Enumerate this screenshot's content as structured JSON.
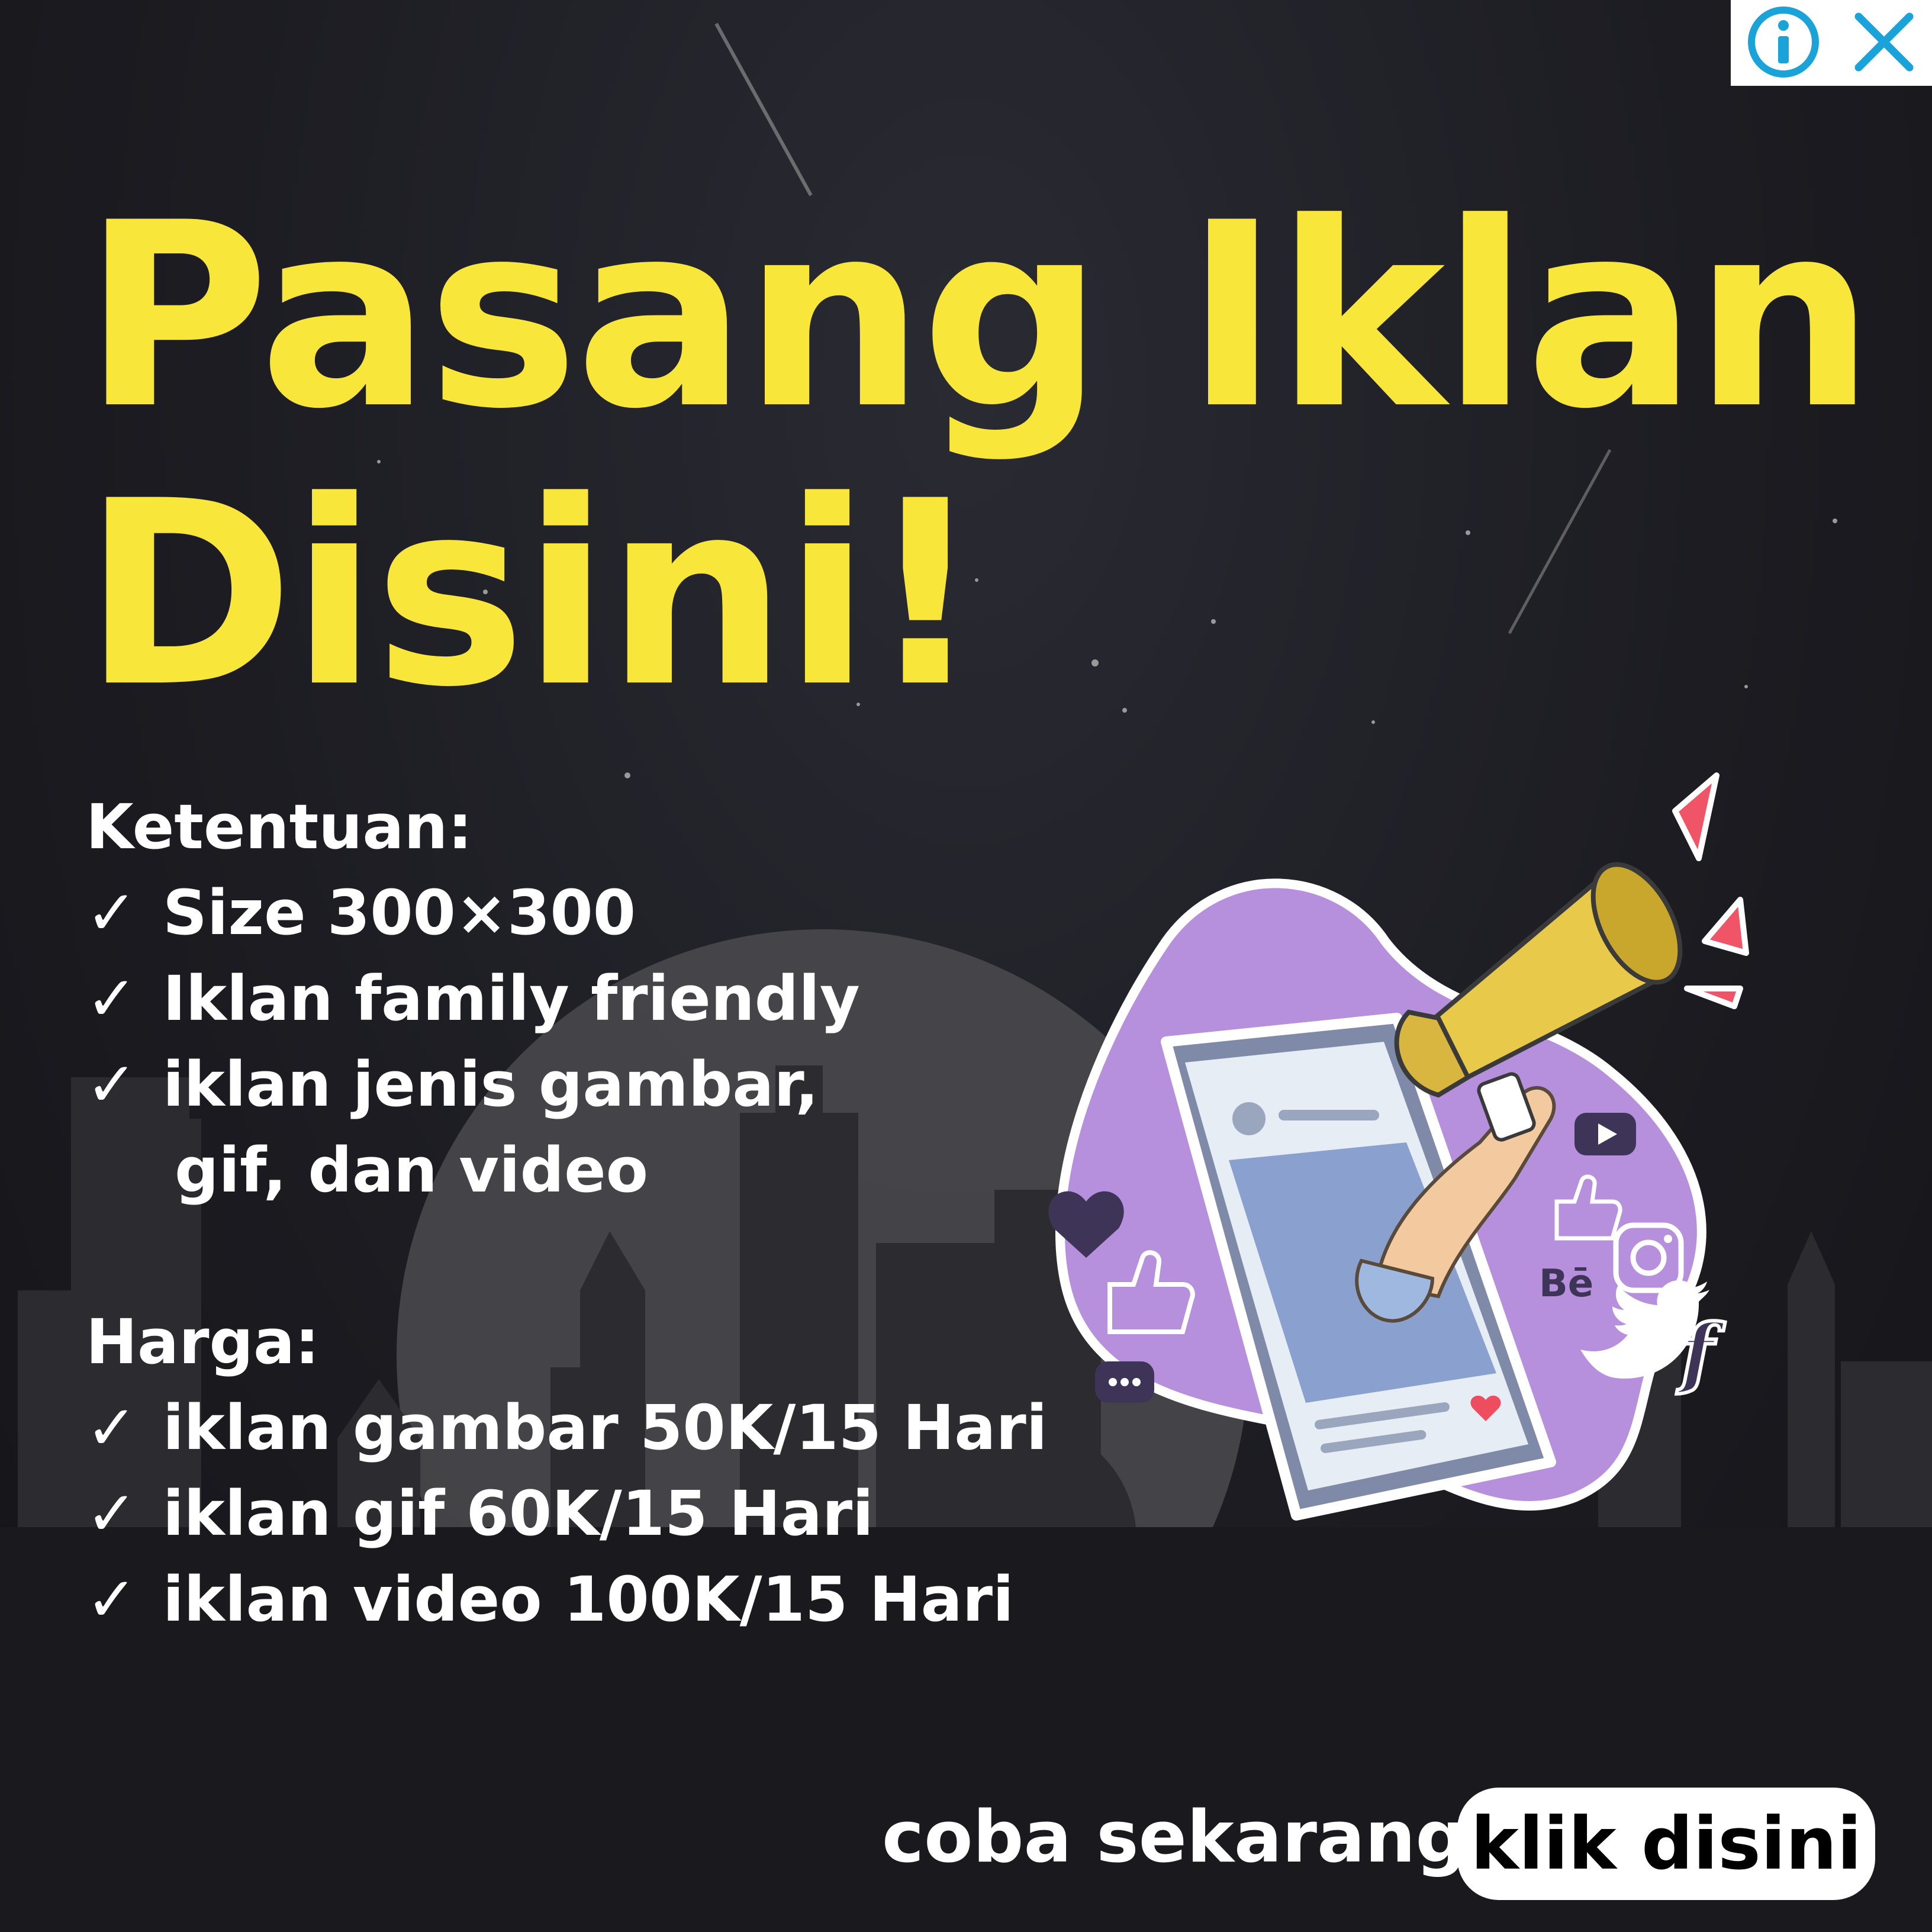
{
  "adchoices": {
    "info_icon": "info-icon",
    "close_icon": "close-icon"
  },
  "headline": {
    "line1": "Pasang Iklan",
    "line2": "Disini!"
  },
  "rules": {
    "title": "Ketentuan:",
    "check_symbol": "✓",
    "items": [
      "Size 300×300",
      "Iklan family friendly",
      "iklan jenis gambar,"
    ],
    "continuation": "gif, dan video"
  },
  "pricing": {
    "title": "Harga:",
    "items": [
      "iklan gambar 50K/15 Hari",
      "iklan gif 60K/15 Hari",
      "iklan video 100K/15 Hari"
    ]
  },
  "cta": {
    "text": "coba sekarang",
    "button_label": "klik disini"
  },
  "illustration": {
    "behance_label": "Bē"
  },
  "colors": {
    "headline": "#f9e63a",
    "text": "#ffffff",
    "background": "#1c1c22",
    "accent_blue": "#1aa3d9",
    "blob": "#b690dc",
    "megaphone": "#e8c94a",
    "spark": "#ef5566"
  }
}
